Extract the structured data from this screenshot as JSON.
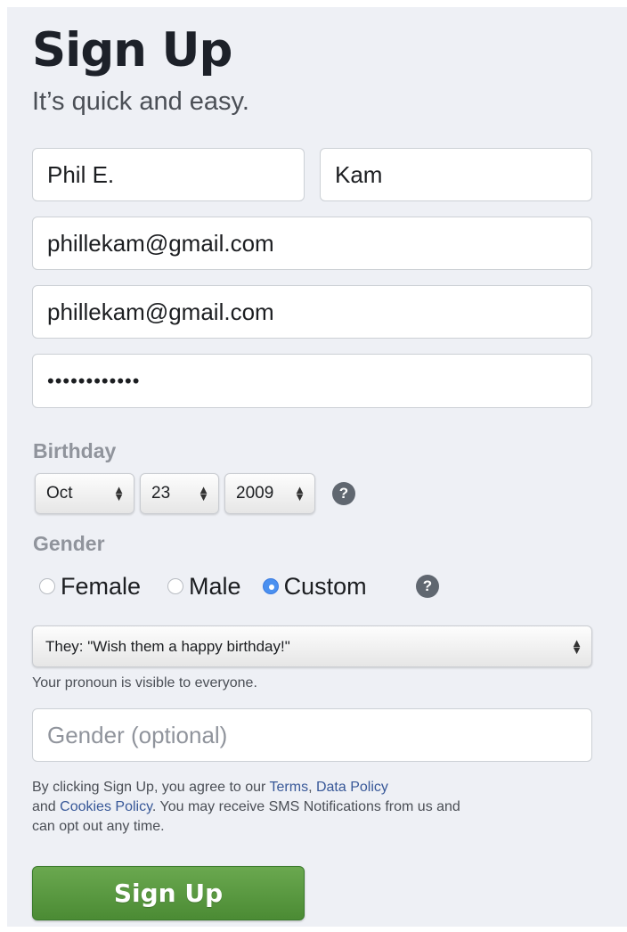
{
  "header": {
    "title": "Sign Up",
    "subtitle": "It’s quick and easy."
  },
  "form": {
    "first_name": "Phil E.",
    "last_name": "Kam",
    "email": "phillekam@gmail.com",
    "email_confirm": "phillekam@gmail.com",
    "password_masked": "••••••••••••",
    "birthday": {
      "label": "Birthday",
      "month": "Oct",
      "day": "23",
      "year": "2009",
      "help": "?"
    },
    "gender": {
      "label": "Gender",
      "options": [
        "Female",
        "Male",
        "Custom"
      ],
      "selected": "Custom",
      "help": "?",
      "pronoun_selected": "They: \"Wish them a happy birthday!\"",
      "pronoun_note": "Your pronoun is visible to everyone.",
      "custom_placeholder": "Gender (optional)"
    }
  },
  "legal": {
    "prefix": "By clicking Sign Up, you agree to our ",
    "terms": "Terms",
    "comma": ", ",
    "data_policy": "Data Policy",
    "and_text": " and ",
    "cookies_policy": "Cookies Policy",
    "suffix": ". You may receive SMS Notifications from us and can opt out any time."
  },
  "actions": {
    "signup_label": "Sign Up"
  },
  "colors": {
    "panel_bg": "#eef0f5",
    "button_green": "#5a9a41",
    "link_blue": "#385898",
    "radio_selected": "#4a90f0"
  }
}
